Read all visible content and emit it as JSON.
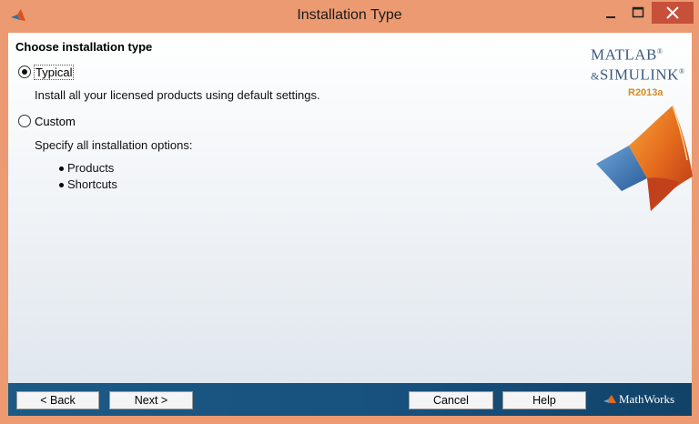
{
  "window": {
    "title": "Installation Type",
    "close_glyph": "✕",
    "minimize_glyph": "—",
    "maximize_glyph": "☐"
  },
  "content": {
    "heading": "Choose installation type",
    "options": [
      {
        "label": "Typical",
        "selected": true,
        "description": "Install all your licensed products using default settings."
      },
      {
        "label": "Custom",
        "selected": false,
        "description": "Specify all installation options:"
      }
    ],
    "custom_bullets": [
      "Products",
      "Shortcuts"
    ]
  },
  "branding": {
    "product_line1": "MATLAB",
    "product_line2": "SIMULINK",
    "release": "R2013a",
    "vendor": "MathWorks",
    "registered": "®"
  },
  "footer": {
    "back_label": "< Back",
    "next_label": "Next >",
    "cancel_label": "Cancel",
    "help_label": "Help"
  },
  "colors": {
    "titlebar": "#ec9a72",
    "close_button": "#c7503a",
    "footer": "#1a5683",
    "brand_text": "#3c5a80",
    "release_text": "#d48b22"
  }
}
